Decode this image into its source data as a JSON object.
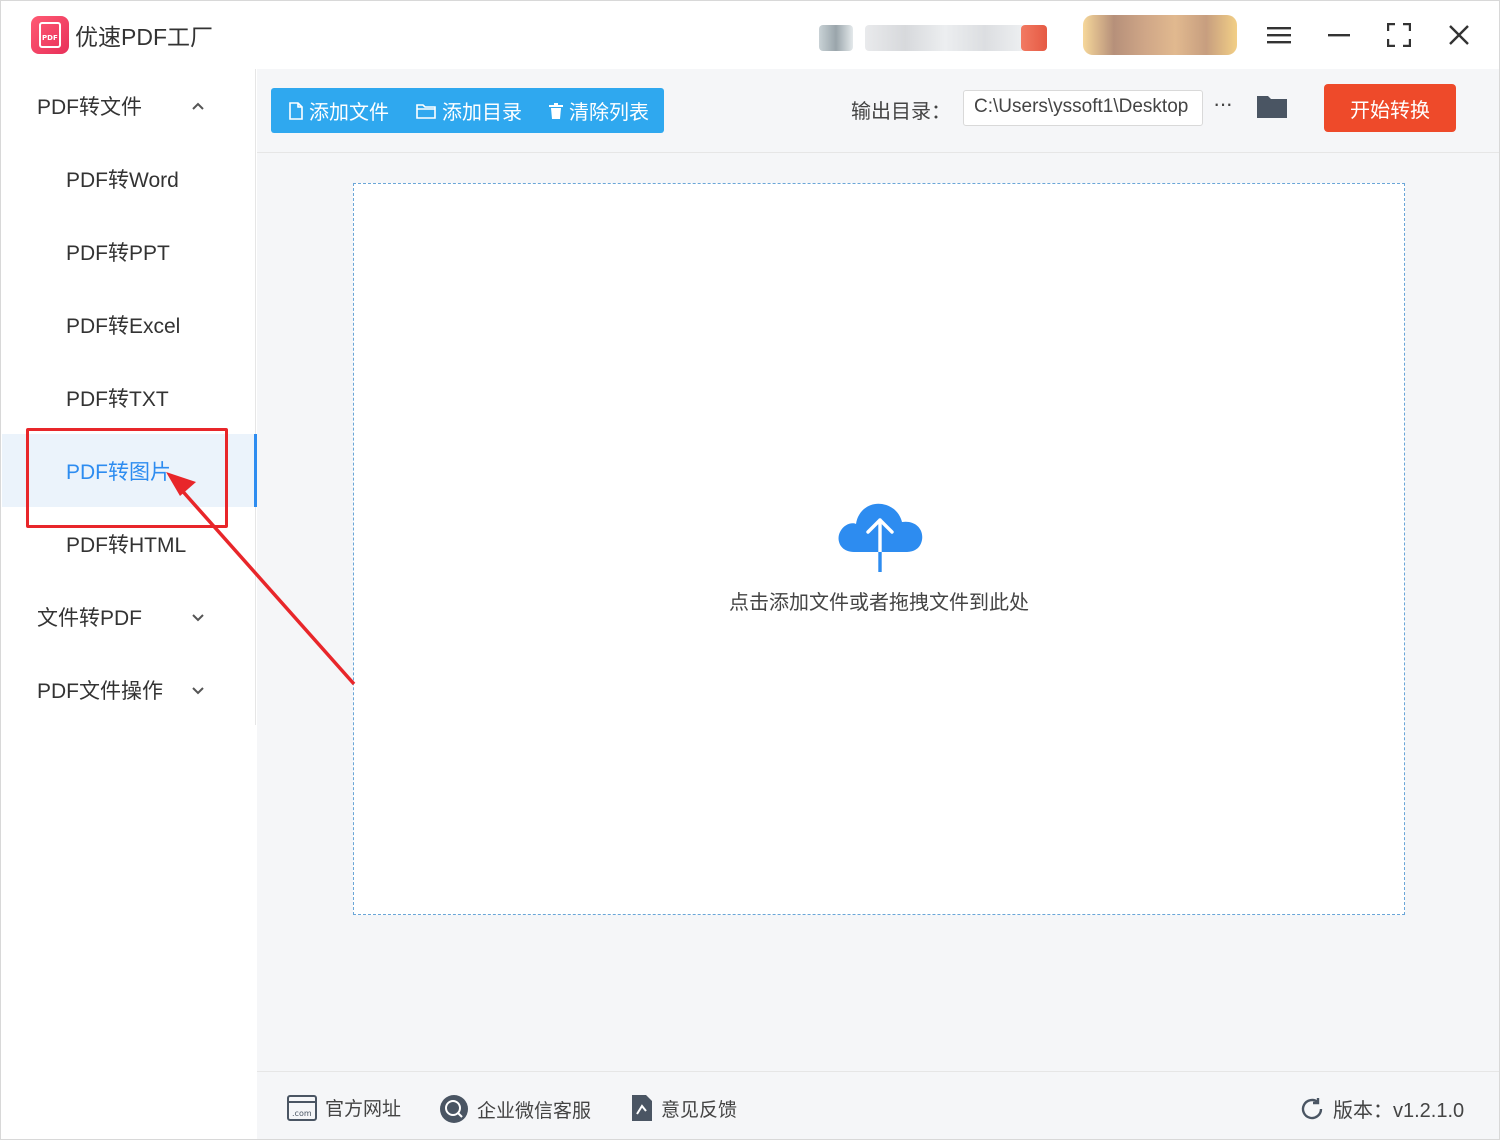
{
  "app": {
    "title": "优速PDF工厂",
    "logo_text": "PDF"
  },
  "titlebar": {
    "icons": [
      "menu-icon",
      "minimize-icon",
      "maximize-icon",
      "close-icon"
    ]
  },
  "sidebar": {
    "groups": [
      {
        "label": "PDF转文件",
        "expanded": true,
        "items": [
          {
            "label": "PDF转Word"
          },
          {
            "label": "PDF转PPT"
          },
          {
            "label": "PDF转Excel"
          },
          {
            "label": "PDF转TXT"
          },
          {
            "label": "PDF转图片",
            "active": true
          },
          {
            "label": "PDF转HTML"
          }
        ]
      },
      {
        "label": "文件转PDF",
        "expanded": false
      },
      {
        "label": "PDF文件操作",
        "expanded": false
      }
    ]
  },
  "toolbar": {
    "add_file": "添加文件",
    "add_dir": "添加目录",
    "clear_list": "清除列表",
    "output_label": "输出目录：",
    "output_path": "C:\\Users\\yssoft1\\Desktop",
    "more": "···",
    "start": "开始转换"
  },
  "dropzone": {
    "text": "点击添加文件或者拖拽文件到此处"
  },
  "footer": {
    "site": "官方网址",
    "wechat": "企业微信客服",
    "feedback": "意见反馈",
    "version": "版本：v1.2.1.0"
  },
  "colors": {
    "accent": "#2d8cf0",
    "toolbar_button": "#2fa8ef",
    "start_button": "#ee4a2a",
    "annotation": "#e8262a"
  }
}
